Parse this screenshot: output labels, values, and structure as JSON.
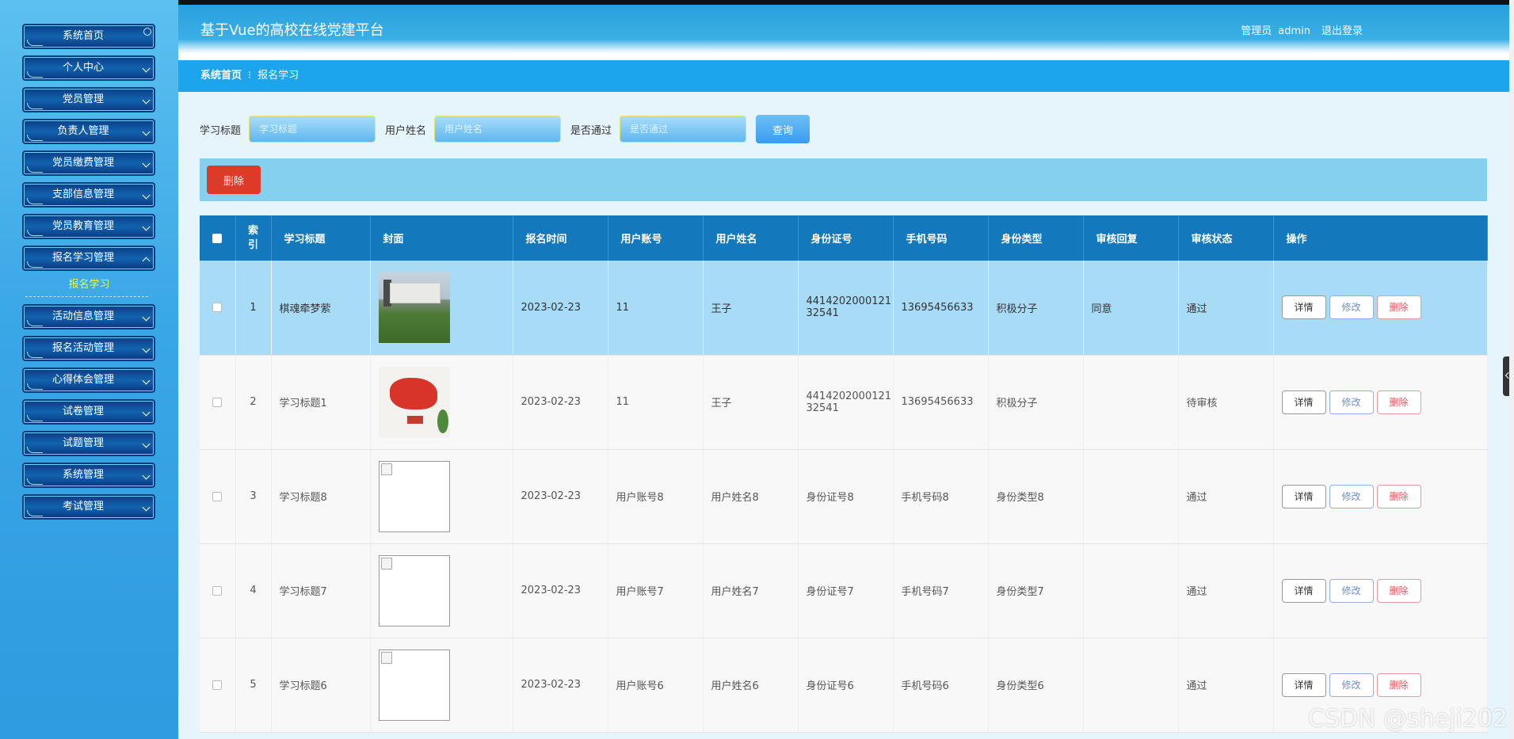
{
  "app": {
    "title": "基于Vue的高校在线党建平台"
  },
  "user": {
    "role": "管理员",
    "name": "admin",
    "logout": "退出登录"
  },
  "sidebar": {
    "items": [
      {
        "label": "系统首页"
      },
      {
        "label": "个人中心"
      },
      {
        "label": "党员管理"
      },
      {
        "label": "负责人管理"
      },
      {
        "label": "党员缴费管理"
      },
      {
        "label": "支部信息管理"
      },
      {
        "label": "党员教育管理"
      },
      {
        "label": "报名学习管理"
      },
      {
        "label": "活动信息管理"
      },
      {
        "label": "报名活动管理"
      },
      {
        "label": "心得体会管理"
      },
      {
        "label": "试卷管理"
      },
      {
        "label": "试题管理"
      },
      {
        "label": "系统管理"
      },
      {
        "label": "考试管理"
      }
    ],
    "active_sub": "报名学习"
  },
  "breadcrumb": {
    "home": "系统首页",
    "separator": "⁝",
    "current": "报名学习"
  },
  "search": {
    "fields": [
      {
        "label": "学习标题",
        "placeholder": "学习标题"
      },
      {
        "label": "用户姓名",
        "placeholder": "用户姓名"
      },
      {
        "label": "是否通过",
        "placeholder": "是否通过"
      }
    ],
    "button": "查询"
  },
  "actions": {
    "delete": "删除"
  },
  "table": {
    "headers": [
      "",
      "索引",
      "学习标题",
      "封面",
      "报名时间",
      "用户账号",
      "用户姓名",
      "身份证号",
      "手机号码",
      "身份类型",
      "审核回复",
      "审核状态",
      "操作"
    ],
    "ops": {
      "detail": "详情",
      "edit": "修改",
      "delete": "删除"
    },
    "rows": [
      {
        "index": "1",
        "title": "棋魂牵梦萦",
        "cover": "building-photo",
        "time": "2023-02-23",
        "account": "11",
        "name": "王子",
        "id": "441420200012132541",
        "id_line1": "4414202000121",
        "id_line2": "32541",
        "phone": "13695456633",
        "type": "积极分子",
        "reply": "同意",
        "status": "通过"
      },
      {
        "index": "2",
        "title": "学习标题1",
        "cover": "china-map-photo",
        "time": "2023-02-23",
        "account": "11",
        "name": "王子",
        "id": "441420200012132541",
        "id_line1": "4414202000121",
        "id_line2": "32541",
        "phone": "13695456633",
        "type": "积极分子",
        "reply": "",
        "status": "待审核"
      },
      {
        "index": "3",
        "title": "学习标题8",
        "cover": "broken-image",
        "time": "2023-02-23",
        "account": "用户账号8",
        "name": "用户姓名8",
        "id": "身份证号8",
        "id_line1": "身份证号8",
        "id_line2": "",
        "phone": "手机号码8",
        "type": "身份类型8",
        "reply": "",
        "status": "通过"
      },
      {
        "index": "4",
        "title": "学习标题7",
        "cover": "broken-image",
        "time": "2023-02-23",
        "account": "用户账号7",
        "name": "用户姓名7",
        "id": "身份证号7",
        "id_line1": "身份证号7",
        "id_line2": "",
        "phone": "手机号码7",
        "type": "身份类型7",
        "reply": "",
        "status": "通过"
      },
      {
        "index": "5",
        "title": "学习标题6",
        "cover": "broken-image",
        "time": "2023-02-23",
        "account": "用户账号6",
        "name": "用户姓名6",
        "id": "身份证号6",
        "id_line1": "身份证号6",
        "id_line2": "",
        "phone": "手机号码6",
        "type": "身份类型6",
        "reply": "",
        "status": "通过"
      }
    ]
  },
  "watermark": "CSDN @sheji202"
}
